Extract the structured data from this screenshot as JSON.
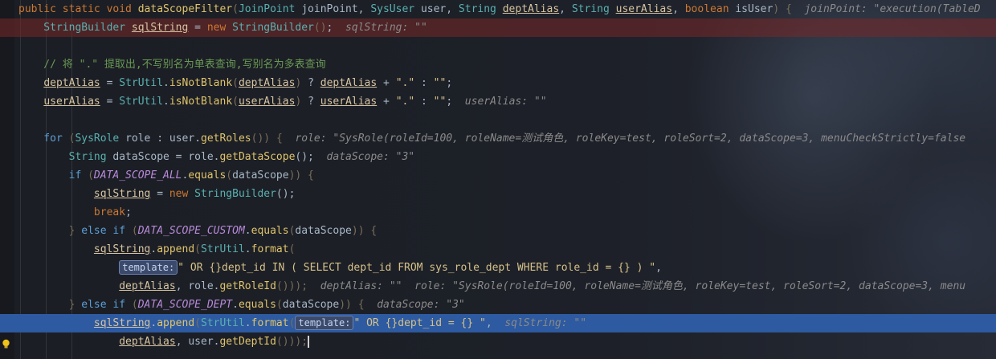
{
  "editor": {
    "lines": [
      {
        "id": "l1",
        "tokens": [
          {
            "t": "public static void ",
            "c": "kw"
          },
          {
            "t": "dataScopeFilter",
            "c": "fn"
          },
          {
            "t": "(",
            "c": "par"
          },
          {
            "t": "JoinPoint ",
            "c": "ty"
          },
          {
            "t": "joinPoint, ",
            "c": "var"
          },
          {
            "t": "SysUser ",
            "c": "ty"
          },
          {
            "t": "user, ",
            "c": "var"
          },
          {
            "t": "String ",
            "c": "ty"
          },
          {
            "t": "deptAlias",
            "c": "und"
          },
          {
            "t": ", ",
            "c": "var"
          },
          {
            "t": "String ",
            "c": "ty"
          },
          {
            "t": "userAlias",
            "c": "und"
          },
          {
            "t": ", ",
            "c": "var"
          },
          {
            "t": "boolean ",
            "c": "kw"
          },
          {
            "t": "isUser",
            "c": "var"
          },
          {
            "t": ") {  ",
            "c": "par"
          },
          {
            "t": "joinPoint: \"execution(TableD",
            "c": "hint"
          }
        ]
      },
      {
        "id": "l2",
        "tokens": [
          {
            "t": "    StringBuilder ",
            "c": "ty"
          },
          {
            "t": "sqlString",
            "c": "und"
          },
          {
            "t": " = ",
            "c": "pn"
          },
          {
            "t": "new ",
            "c": "kw"
          },
          {
            "t": "StringBuilder",
            "c": "ty"
          },
          {
            "t": "()",
            "c": "par"
          },
          {
            "t": ";  ",
            "c": "pn"
          },
          {
            "t": "sqlString: \"\"",
            "c": "hint"
          }
        ]
      },
      {
        "id": "l3",
        "tokens": []
      },
      {
        "id": "l4",
        "tokens": [
          {
            "t": "    // 将 \".\" 提取出,不写别名为单表查询,写别名为多表查询",
            "c": "cmt"
          }
        ]
      },
      {
        "id": "l5",
        "tokens": [
          {
            "t": "    ",
            "c": "pn"
          },
          {
            "t": "deptAlias",
            "c": "und"
          },
          {
            "t": " = ",
            "c": "pn"
          },
          {
            "t": "StrUtil",
            "c": "ty"
          },
          {
            "t": ".",
            "c": "pn"
          },
          {
            "t": "isNotBlank",
            "c": "fn"
          },
          {
            "t": "(",
            "c": "par"
          },
          {
            "t": "deptAlias",
            "c": "und"
          },
          {
            "t": ")",
            "c": "par"
          },
          {
            "t": " ? ",
            "c": "pn"
          },
          {
            "t": "deptAlias",
            "c": "und"
          },
          {
            "t": " + ",
            "c": "pn"
          },
          {
            "t": "\".\"",
            "c": "str"
          },
          {
            "t": " : ",
            "c": "pn"
          },
          {
            "t": "\"\"",
            "c": "str"
          },
          {
            "t": ";",
            "c": "pn"
          }
        ]
      },
      {
        "id": "l6",
        "tokens": [
          {
            "t": "    ",
            "c": "pn"
          },
          {
            "t": "userAlias",
            "c": "und"
          },
          {
            "t": " = ",
            "c": "pn"
          },
          {
            "t": "StrUtil",
            "c": "ty"
          },
          {
            "t": ".",
            "c": "pn"
          },
          {
            "t": "isNotBlank",
            "c": "fn"
          },
          {
            "t": "(",
            "c": "par"
          },
          {
            "t": "userAlias",
            "c": "und"
          },
          {
            "t": ")",
            "c": "par"
          },
          {
            "t": " ? ",
            "c": "pn"
          },
          {
            "t": "userAlias",
            "c": "und"
          },
          {
            "t": " + ",
            "c": "pn"
          },
          {
            "t": "\".\"",
            "c": "str"
          },
          {
            "t": " : ",
            "c": "pn"
          },
          {
            "t": "\"\"",
            "c": "str"
          },
          {
            "t": ";  ",
            "c": "pn"
          },
          {
            "t": "userAlias: \"\"",
            "c": "hint"
          }
        ]
      },
      {
        "id": "l7",
        "tokens": []
      },
      {
        "id": "l8",
        "tokens": [
          {
            "t": "    for ",
            "c": "kw2"
          },
          {
            "t": "(",
            "c": "par"
          },
          {
            "t": "SysRole ",
            "c": "ty"
          },
          {
            "t": "role",
            "c": "var"
          },
          {
            "t": " : ",
            "c": "pn"
          },
          {
            "t": "user",
            "c": "var"
          },
          {
            "t": ".",
            "c": "pn"
          },
          {
            "t": "getRoles",
            "c": "fn"
          },
          {
            "t": "()) {  ",
            "c": "par"
          },
          {
            "t": "role: \"SysRole(roleId=100, roleName=测试角色, roleKey=test, roleSort=2, dataScope=3, menuCheckStrictly=false",
            "c": "hint"
          }
        ]
      },
      {
        "id": "l9",
        "tokens": [
          {
            "t": "        String ",
            "c": "ty"
          },
          {
            "t": "dataScope",
            "c": "var"
          },
          {
            "t": " = ",
            "c": "pn"
          },
          {
            "t": "role",
            "c": "var"
          },
          {
            "t": ".",
            "c": "pn"
          },
          {
            "t": "getDataScope",
            "c": "fn"
          },
          {
            "t": "();  ",
            "c": "pn"
          },
          {
            "t": "dataScope: \"3\"",
            "c": "hint"
          }
        ]
      },
      {
        "id": "l10",
        "tokens": [
          {
            "t": "        if ",
            "c": "kw2"
          },
          {
            "t": "(",
            "c": "par"
          },
          {
            "t": "DATA_SCOPE_ALL",
            "c": "fld"
          },
          {
            "t": ".",
            "c": "pn"
          },
          {
            "t": "equals",
            "c": "fn"
          },
          {
            "t": "(",
            "c": "par"
          },
          {
            "t": "dataScope",
            "c": "var"
          },
          {
            "t": ")) {",
            "c": "par"
          }
        ]
      },
      {
        "id": "l11",
        "tokens": [
          {
            "t": "            ",
            "c": "pn"
          },
          {
            "t": "sqlString",
            "c": "und"
          },
          {
            "t": " = ",
            "c": "pn"
          },
          {
            "t": "new ",
            "c": "kw"
          },
          {
            "t": "StringBuilder",
            "c": "ty"
          },
          {
            "t": "();",
            "c": "pn"
          }
        ]
      },
      {
        "id": "l12",
        "tokens": [
          {
            "t": "            break",
            "c": "kw"
          },
          {
            "t": ";",
            "c": "pn"
          }
        ]
      },
      {
        "id": "l13",
        "tokens": [
          {
            "t": "        } ",
            "c": "par"
          },
          {
            "t": "else if ",
            "c": "kw2"
          },
          {
            "t": "(",
            "c": "par"
          },
          {
            "t": "DATA_SCOPE_CUSTOM",
            "c": "fld"
          },
          {
            "t": ".",
            "c": "pn"
          },
          {
            "t": "equals",
            "c": "fn"
          },
          {
            "t": "(",
            "c": "par"
          },
          {
            "t": "dataScope",
            "c": "var"
          },
          {
            "t": ")) {",
            "c": "par"
          }
        ]
      },
      {
        "id": "l14",
        "tokens": [
          {
            "t": "            ",
            "c": "pn"
          },
          {
            "t": "sqlString",
            "c": "und"
          },
          {
            "t": ".",
            "c": "pn"
          },
          {
            "t": "append",
            "c": "fn"
          },
          {
            "t": "(",
            "c": "par"
          },
          {
            "t": "StrUtil",
            "c": "ty"
          },
          {
            "t": ".",
            "c": "pn"
          },
          {
            "t": "format",
            "c": "fn"
          },
          {
            "t": "(",
            "c": "par"
          }
        ]
      },
      {
        "id": "l15",
        "tokens": [
          {
            "t": "                ",
            "c": "pn"
          },
          {
            "t": "template:",
            "c": "badge"
          },
          {
            "t": "\" OR {}dept_id IN ( SELECT dept_id FROM sys_role_dept WHERE role_id = {} ) \"",
            "c": "str"
          },
          {
            "t": ",",
            "c": "pn"
          }
        ]
      },
      {
        "id": "l16",
        "tokens": [
          {
            "t": "                ",
            "c": "pn"
          },
          {
            "t": "deptAlias",
            "c": "und"
          },
          {
            "t": ", ",
            "c": "pn"
          },
          {
            "t": "role",
            "c": "var"
          },
          {
            "t": ".",
            "c": "pn"
          },
          {
            "t": "getRoleId",
            "c": "fn"
          },
          {
            "t": "()));  ",
            "c": "par"
          },
          {
            "t": "deptAlias: \"\"  role: \"SysRole(roleId=100, roleName=测试角色, roleKey=test, roleSort=2, dataScope=3, menu",
            "c": "hint"
          }
        ]
      },
      {
        "id": "l17",
        "tokens": [
          {
            "t": "        } ",
            "c": "par"
          },
          {
            "t": "else if ",
            "c": "kw2"
          },
          {
            "t": "(",
            "c": "par"
          },
          {
            "t": "DATA_SCOPE_DEPT",
            "c": "fld"
          },
          {
            "t": ".",
            "c": "pn"
          },
          {
            "t": "equals",
            "c": "fn"
          },
          {
            "t": "(",
            "c": "par"
          },
          {
            "t": "dataScope",
            "c": "var"
          },
          {
            "t": ")) {  ",
            "c": "par"
          },
          {
            "t": "dataScope: \"3\"",
            "c": "hint"
          }
        ]
      },
      {
        "id": "l18",
        "tokens": [
          {
            "t": "            ",
            "c": "pn"
          },
          {
            "t": "sqlString",
            "c": "und"
          },
          {
            "t": ".",
            "c": "pn"
          },
          {
            "t": "append",
            "c": "fn"
          },
          {
            "t": "(",
            "c": "par"
          },
          {
            "t": "StrUtil",
            "c": "ty"
          },
          {
            "t": ".",
            "c": "pn"
          },
          {
            "t": "format",
            "c": "fn"
          },
          {
            "t": "(",
            "c": "par"
          },
          {
            "t": "template:",
            "c": "badge"
          },
          {
            "t": "\" OR {}dept_id = {} \"",
            "c": "str"
          },
          {
            "t": ",  ",
            "c": "pn"
          },
          {
            "t": "sqlString: \"\"",
            "c": "hint"
          }
        ]
      },
      {
        "id": "l19",
        "tokens": [
          {
            "t": "                ",
            "c": "pn"
          },
          {
            "t": "deptAlias",
            "c": "und"
          },
          {
            "t": ", ",
            "c": "pn"
          },
          {
            "t": "user",
            "c": "var"
          },
          {
            "t": ".",
            "c": "pn"
          },
          {
            "t": "getDeptId",
            "c": "fn"
          },
          {
            "t": "()));",
            "c": "par"
          },
          {
            "t": "",
            "c": "caret"
          }
        ]
      }
    ]
  },
  "gutter": {
    "intention_icon": "lightbulb-icon"
  }
}
